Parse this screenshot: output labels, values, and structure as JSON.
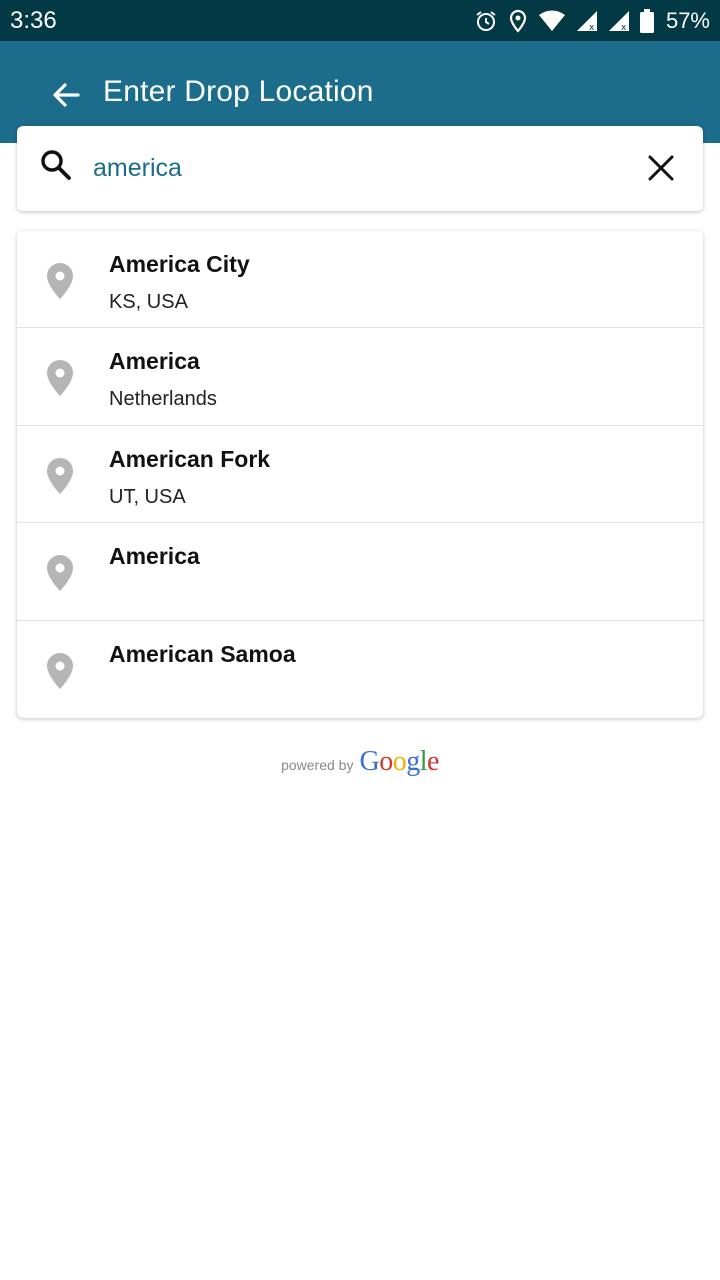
{
  "status_bar": {
    "time": "3:36",
    "battery_percent": "57%",
    "icons": [
      "alarm-icon",
      "location-icon",
      "wifi-icon",
      "signal-icon",
      "signal-icon",
      "battery-icon"
    ]
  },
  "app_bar": {
    "title": "Enter Drop Location",
    "background_color": "#1b6d8b",
    "back_icon": "arrow-left-icon"
  },
  "search": {
    "value": "america",
    "search_icon": "search-icon",
    "clear_icon": "close-icon"
  },
  "results": [
    {
      "title": "America City",
      "subtitle": "KS, USA"
    },
    {
      "title": "America",
      "subtitle": "Netherlands"
    },
    {
      "title": "American Fork",
      "subtitle": "UT, USA"
    },
    {
      "title": "America",
      "subtitle": ""
    },
    {
      "title": "American Samoa",
      "subtitle": ""
    }
  ],
  "attribution": {
    "powered_by": "powered by",
    "logo_text": "Google"
  }
}
